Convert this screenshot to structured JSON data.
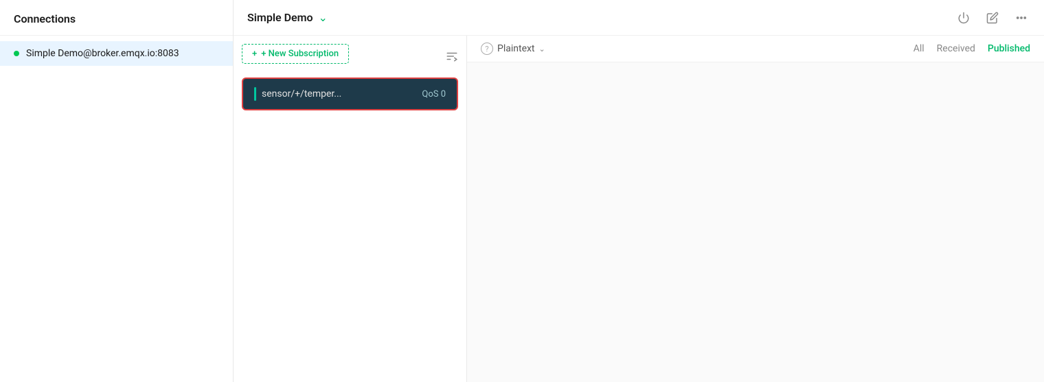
{
  "sidebar": {
    "title": "Connections",
    "items": [
      {
        "label": "Simple Demo@broker.emqx.io:8083",
        "status": "connected",
        "statusColor": "#00c853"
      }
    ]
  },
  "main": {
    "title": "Simple Demo",
    "chevron": "⌄",
    "icons": {
      "power": "⏻",
      "edit": "✎",
      "more": "⋯"
    }
  },
  "subscriptions": {
    "new_button_label": "+ New Subscription",
    "filter_icon": "≡",
    "items": [
      {
        "topic": "sensor/+/temper...",
        "qos": "QoS 0",
        "indicator_color": "#00c8a0"
      }
    ]
  },
  "messages": {
    "plaintext_label": "Plaintext",
    "tabs": [
      {
        "label": "All",
        "active": false
      },
      {
        "label": "Received",
        "active": false
      },
      {
        "label": "Published",
        "active": true
      }
    ]
  }
}
